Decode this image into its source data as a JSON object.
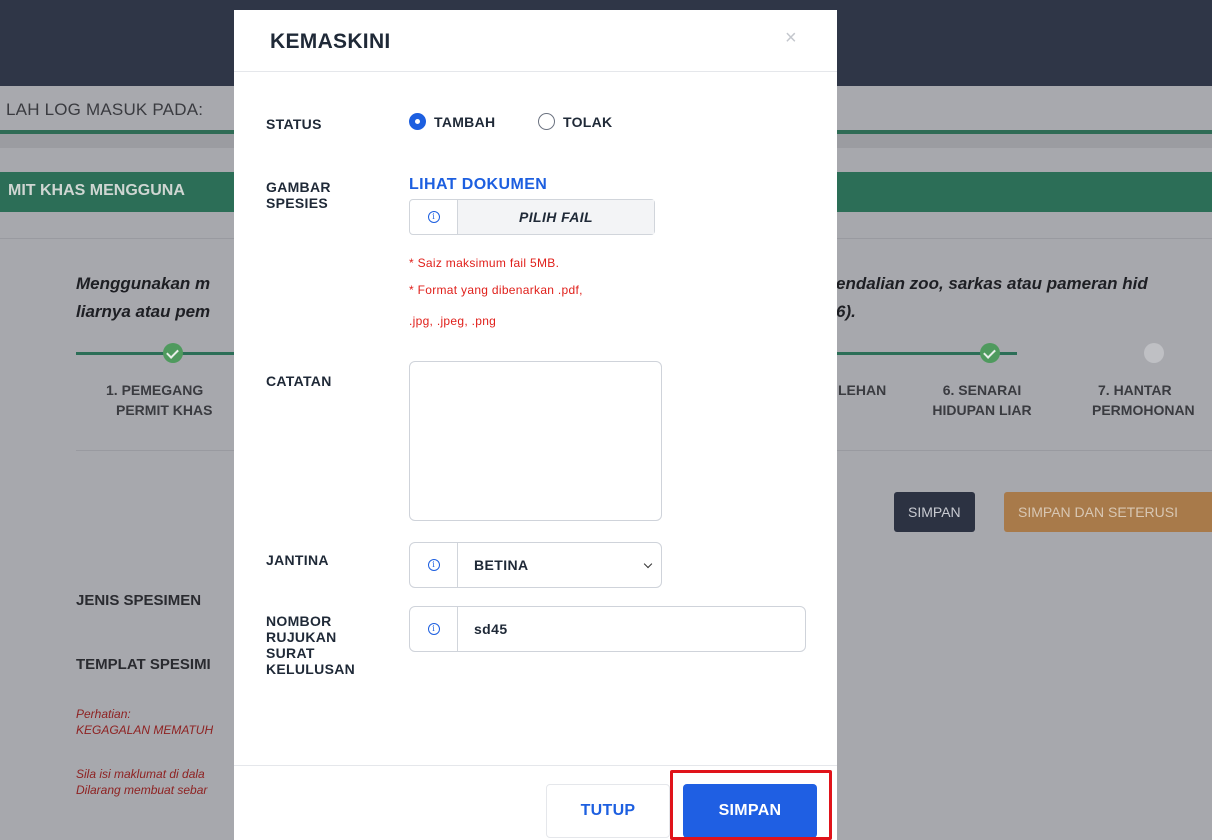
{
  "background": {
    "login_text": "LAH LOG MASUK PADA:",
    "section_title": "MIT KHAS MENGGUNA",
    "desc_left_line1": "Menggunakan m",
    "desc_left_line2": "liarnya atau pem",
    "desc_right_line1": "endalian zoo, sarkas atau pameran hid",
    "desc_right_line2": "6).",
    "steps": [
      {
        "label_line1": "1. PEMEGANG",
        "label_line2": "PERMIT KHAS",
        "state": "done"
      },
      {
        "label_line1": "LEHAN",
        "label_line2": "",
        "state": "done"
      },
      {
        "label_line1": "6. SENARAI",
        "label_line2": "HIDUPAN LIAR",
        "state": "done"
      },
      {
        "label_line1": "7. HANTAR",
        "label_line2": "PERMOHONAN",
        "state": "todo"
      }
    ],
    "btn_simpan": "SIMPAN",
    "btn_simpan_seterus": "SIMPAN DAN SETERUSI",
    "jenis_spesimen": "JENIS SPESIMEN",
    "templat_spesimen": "TEMPLAT SPESIMI",
    "perhatian": "Perhatian:",
    "kegagalan": "KEGAGALAN MEMATUH",
    "sila_isi": "Sila isi maklumat di dala",
    "dilarang": "Dilarang membuat sebar"
  },
  "modal": {
    "title": "KEMASKINI",
    "close_glyph": "×",
    "status_label": "STATUS",
    "status_options": [
      {
        "label": "TAMBAH",
        "selected": true
      },
      {
        "label": "TOLAK",
        "selected": false
      }
    ],
    "gambar_label_line1": "GAMBAR",
    "gambar_label_line2": "SPESIES",
    "lihat_dokumen": "LIHAT DOKUMEN",
    "info_glyph": "i",
    "pilih_fail": "PILIH FAIL",
    "note_size": "* Saiz maksimum fail 5MB.",
    "note_format_line1": "* Format yang dibenarkan .pdf,",
    "note_format_line2": ".jpg, .jpeg, .png",
    "catatan_label": "CATATAN",
    "catatan_value": "",
    "jantina_label": "JANTINA",
    "jantina_value": "BETINA",
    "nombor_label_lines": [
      "NOMBOR",
      "RUJUKAN",
      "SURAT",
      "KELULUSAN"
    ],
    "nombor_value": "sd45",
    "btn_tutup": "TUTUP",
    "btn_simpan": "SIMPAN"
  },
  "colors": {
    "primary": "#1f5fe3",
    "warning_text": "#e0201b",
    "highlight": "#e0131a",
    "header_dark": "#2f3647",
    "green": "#2c6e57"
  }
}
